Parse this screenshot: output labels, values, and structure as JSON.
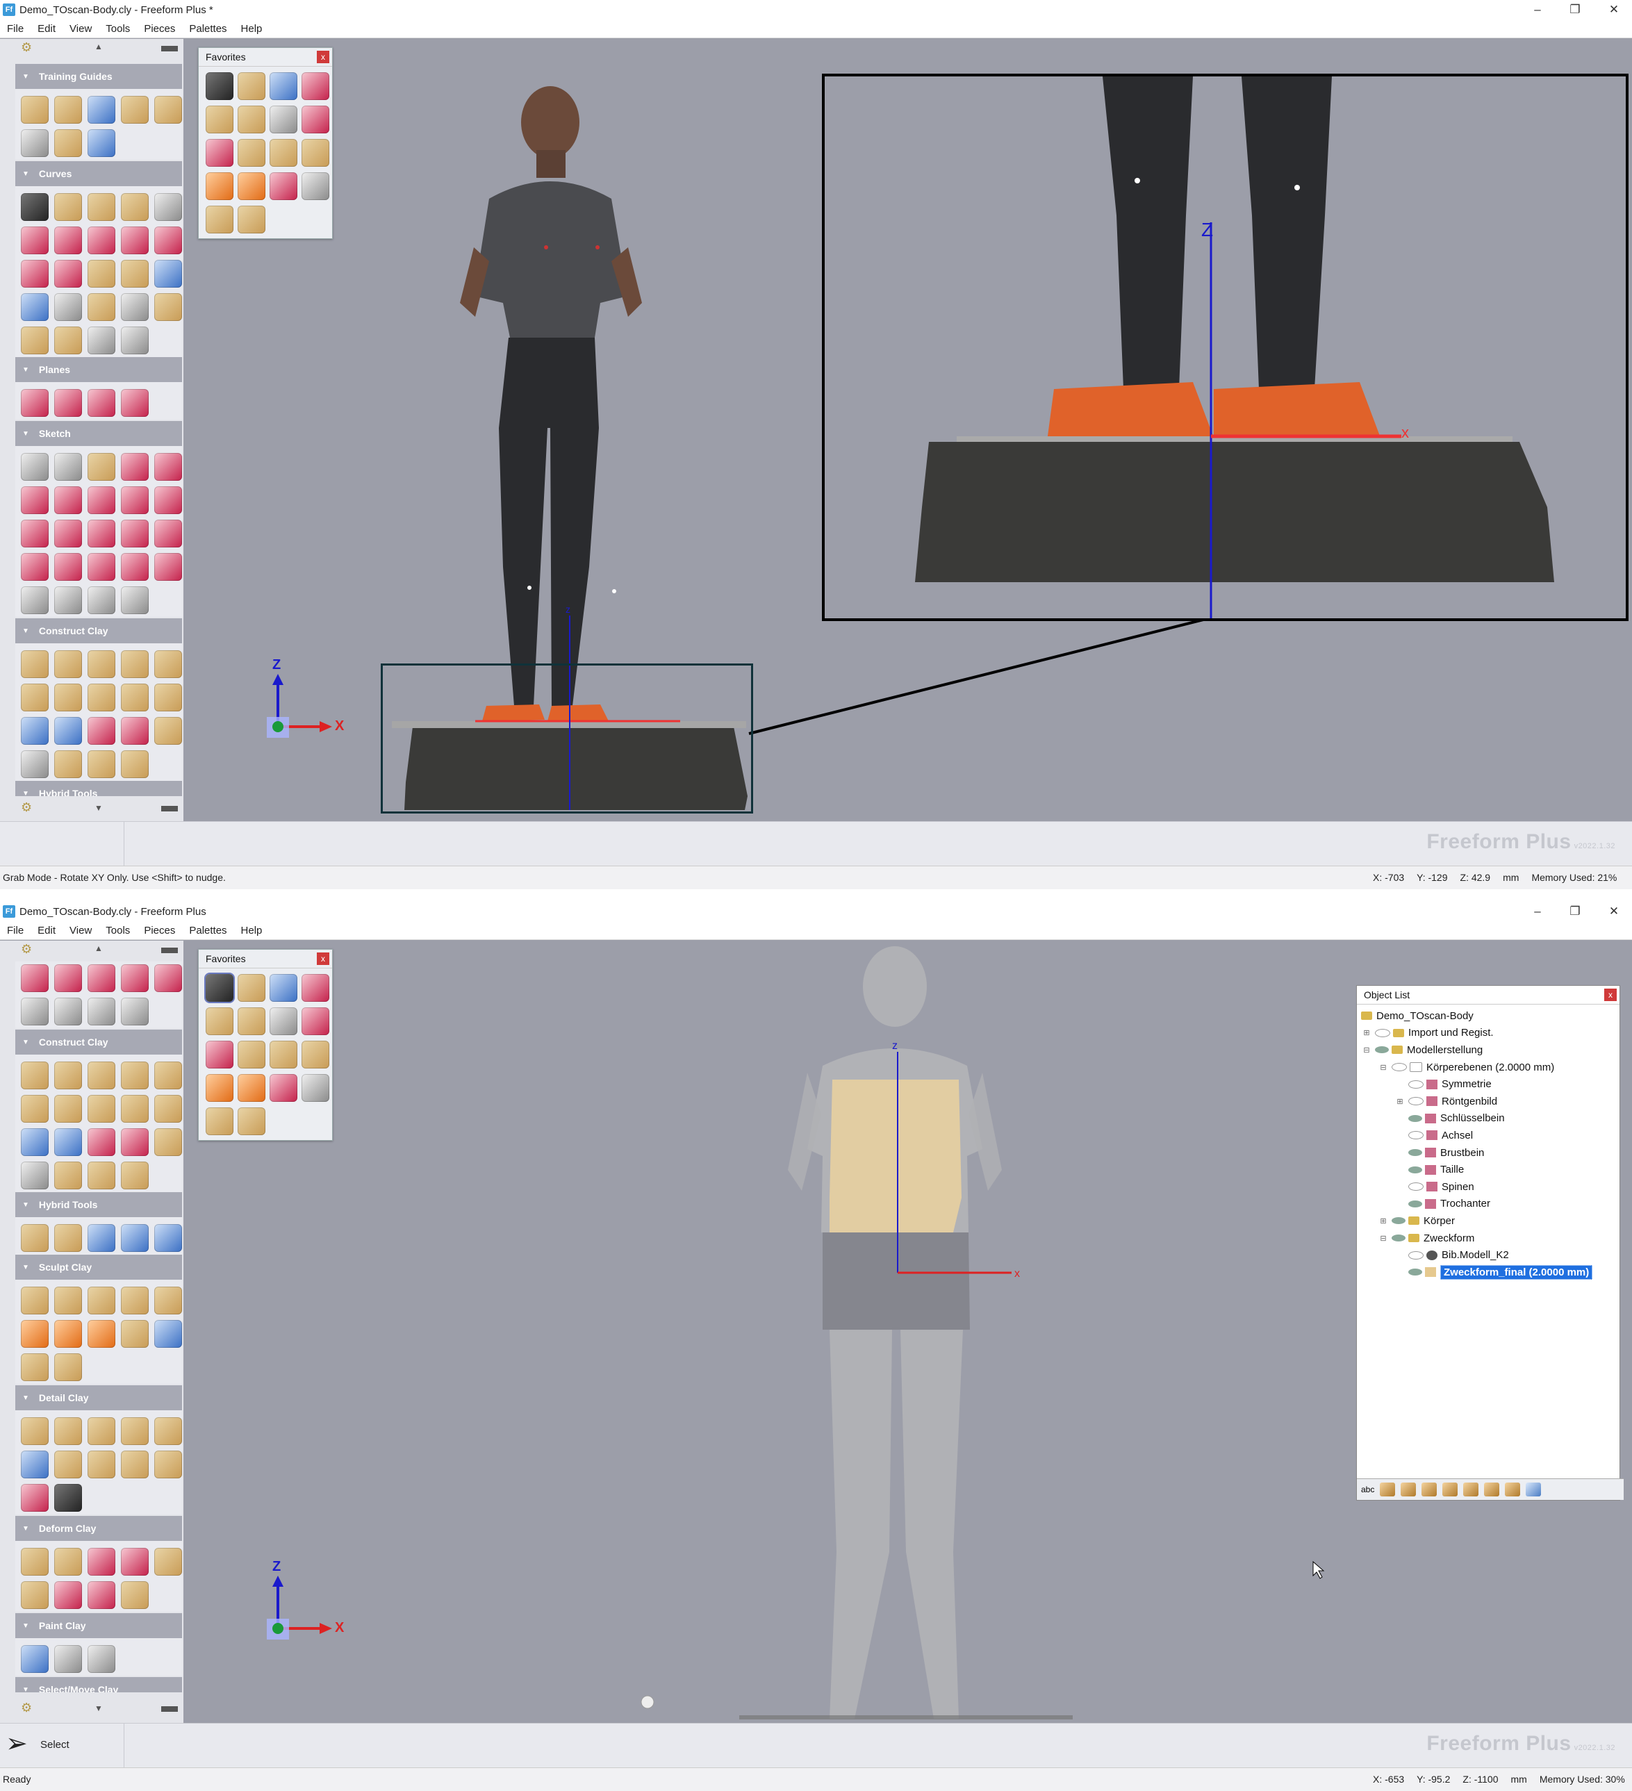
{
  "top": {
    "title": "Demo_TOscan-Body.cly - Freeform Plus *",
    "menu": [
      "File",
      "Edit",
      "View",
      "Tools",
      "Pieces",
      "Palettes",
      "Help"
    ],
    "palettes": [
      "Training Guides",
      "Curves",
      "Planes",
      "Sketch",
      "Construct Clay",
      "Hybrid Tools"
    ],
    "favorites_title": "Favorites",
    "status_message": "Grab Mode - Rotate XY Only.  Use <Shift> to nudge.",
    "coords": {
      "x": "X: -703",
      "y": "Y: -129",
      "z": "Z: 42.9",
      "unit": "mm",
      "memory": "Memory Used: 21%"
    },
    "axes": {
      "z": "Z",
      "x": "X"
    }
  },
  "bottom": {
    "title": "Demo_TOscan-Body.cly - Freeform Plus",
    "menu": [
      "File",
      "Edit",
      "View",
      "Tools",
      "Pieces",
      "Palettes",
      "Help"
    ],
    "palettes": [
      "Construct Clay",
      "Hybrid Tools",
      "Sculpt Clay",
      "Detail Clay",
      "Deform Clay",
      "Paint Clay",
      "Select/Move Clay"
    ],
    "favorites_title": "Favorites",
    "select_label": "Select",
    "status_message": "Ready",
    "coords": {
      "x": "X: -653",
      "y": "Y: -95.2",
      "z": "Z: -1100",
      "unit": "mm",
      "memory": "Memory Used: 30%"
    },
    "axes": {
      "z": "Z",
      "x": "X"
    },
    "object_list": {
      "title": "Object List",
      "tool_abc": "abc",
      "items": [
        {
          "label": "Demo_TOscan-Body",
          "depth": 0
        },
        {
          "label": "Import und Regist.",
          "depth": 1
        },
        {
          "label": "Modellerstellung",
          "depth": 1
        },
        {
          "label": "Körperebenen (2.0000 mm)",
          "depth": 2
        },
        {
          "label": "Symmetrie",
          "depth": 3
        },
        {
          "label": "Röntgenbild",
          "depth": 3
        },
        {
          "label": "Schlüsselbein",
          "depth": 3
        },
        {
          "label": "Achsel",
          "depth": 3
        },
        {
          "label": "Brustbein",
          "depth": 3
        },
        {
          "label": "Taille",
          "depth": 3
        },
        {
          "label": "Spinen",
          "depth": 3
        },
        {
          "label": "Trochanter",
          "depth": 3
        },
        {
          "label": "Körper",
          "depth": 2
        },
        {
          "label": "Zweckform",
          "depth": 2
        },
        {
          "label": "Bib.Modell_K2",
          "depth": 3
        },
        {
          "label": "Zweckform_final (2.0000 mm)",
          "depth": 3,
          "selected": true
        }
      ]
    }
  },
  "brand": {
    "name": "Freeform Plus",
    "version": "v2022.1.32"
  }
}
